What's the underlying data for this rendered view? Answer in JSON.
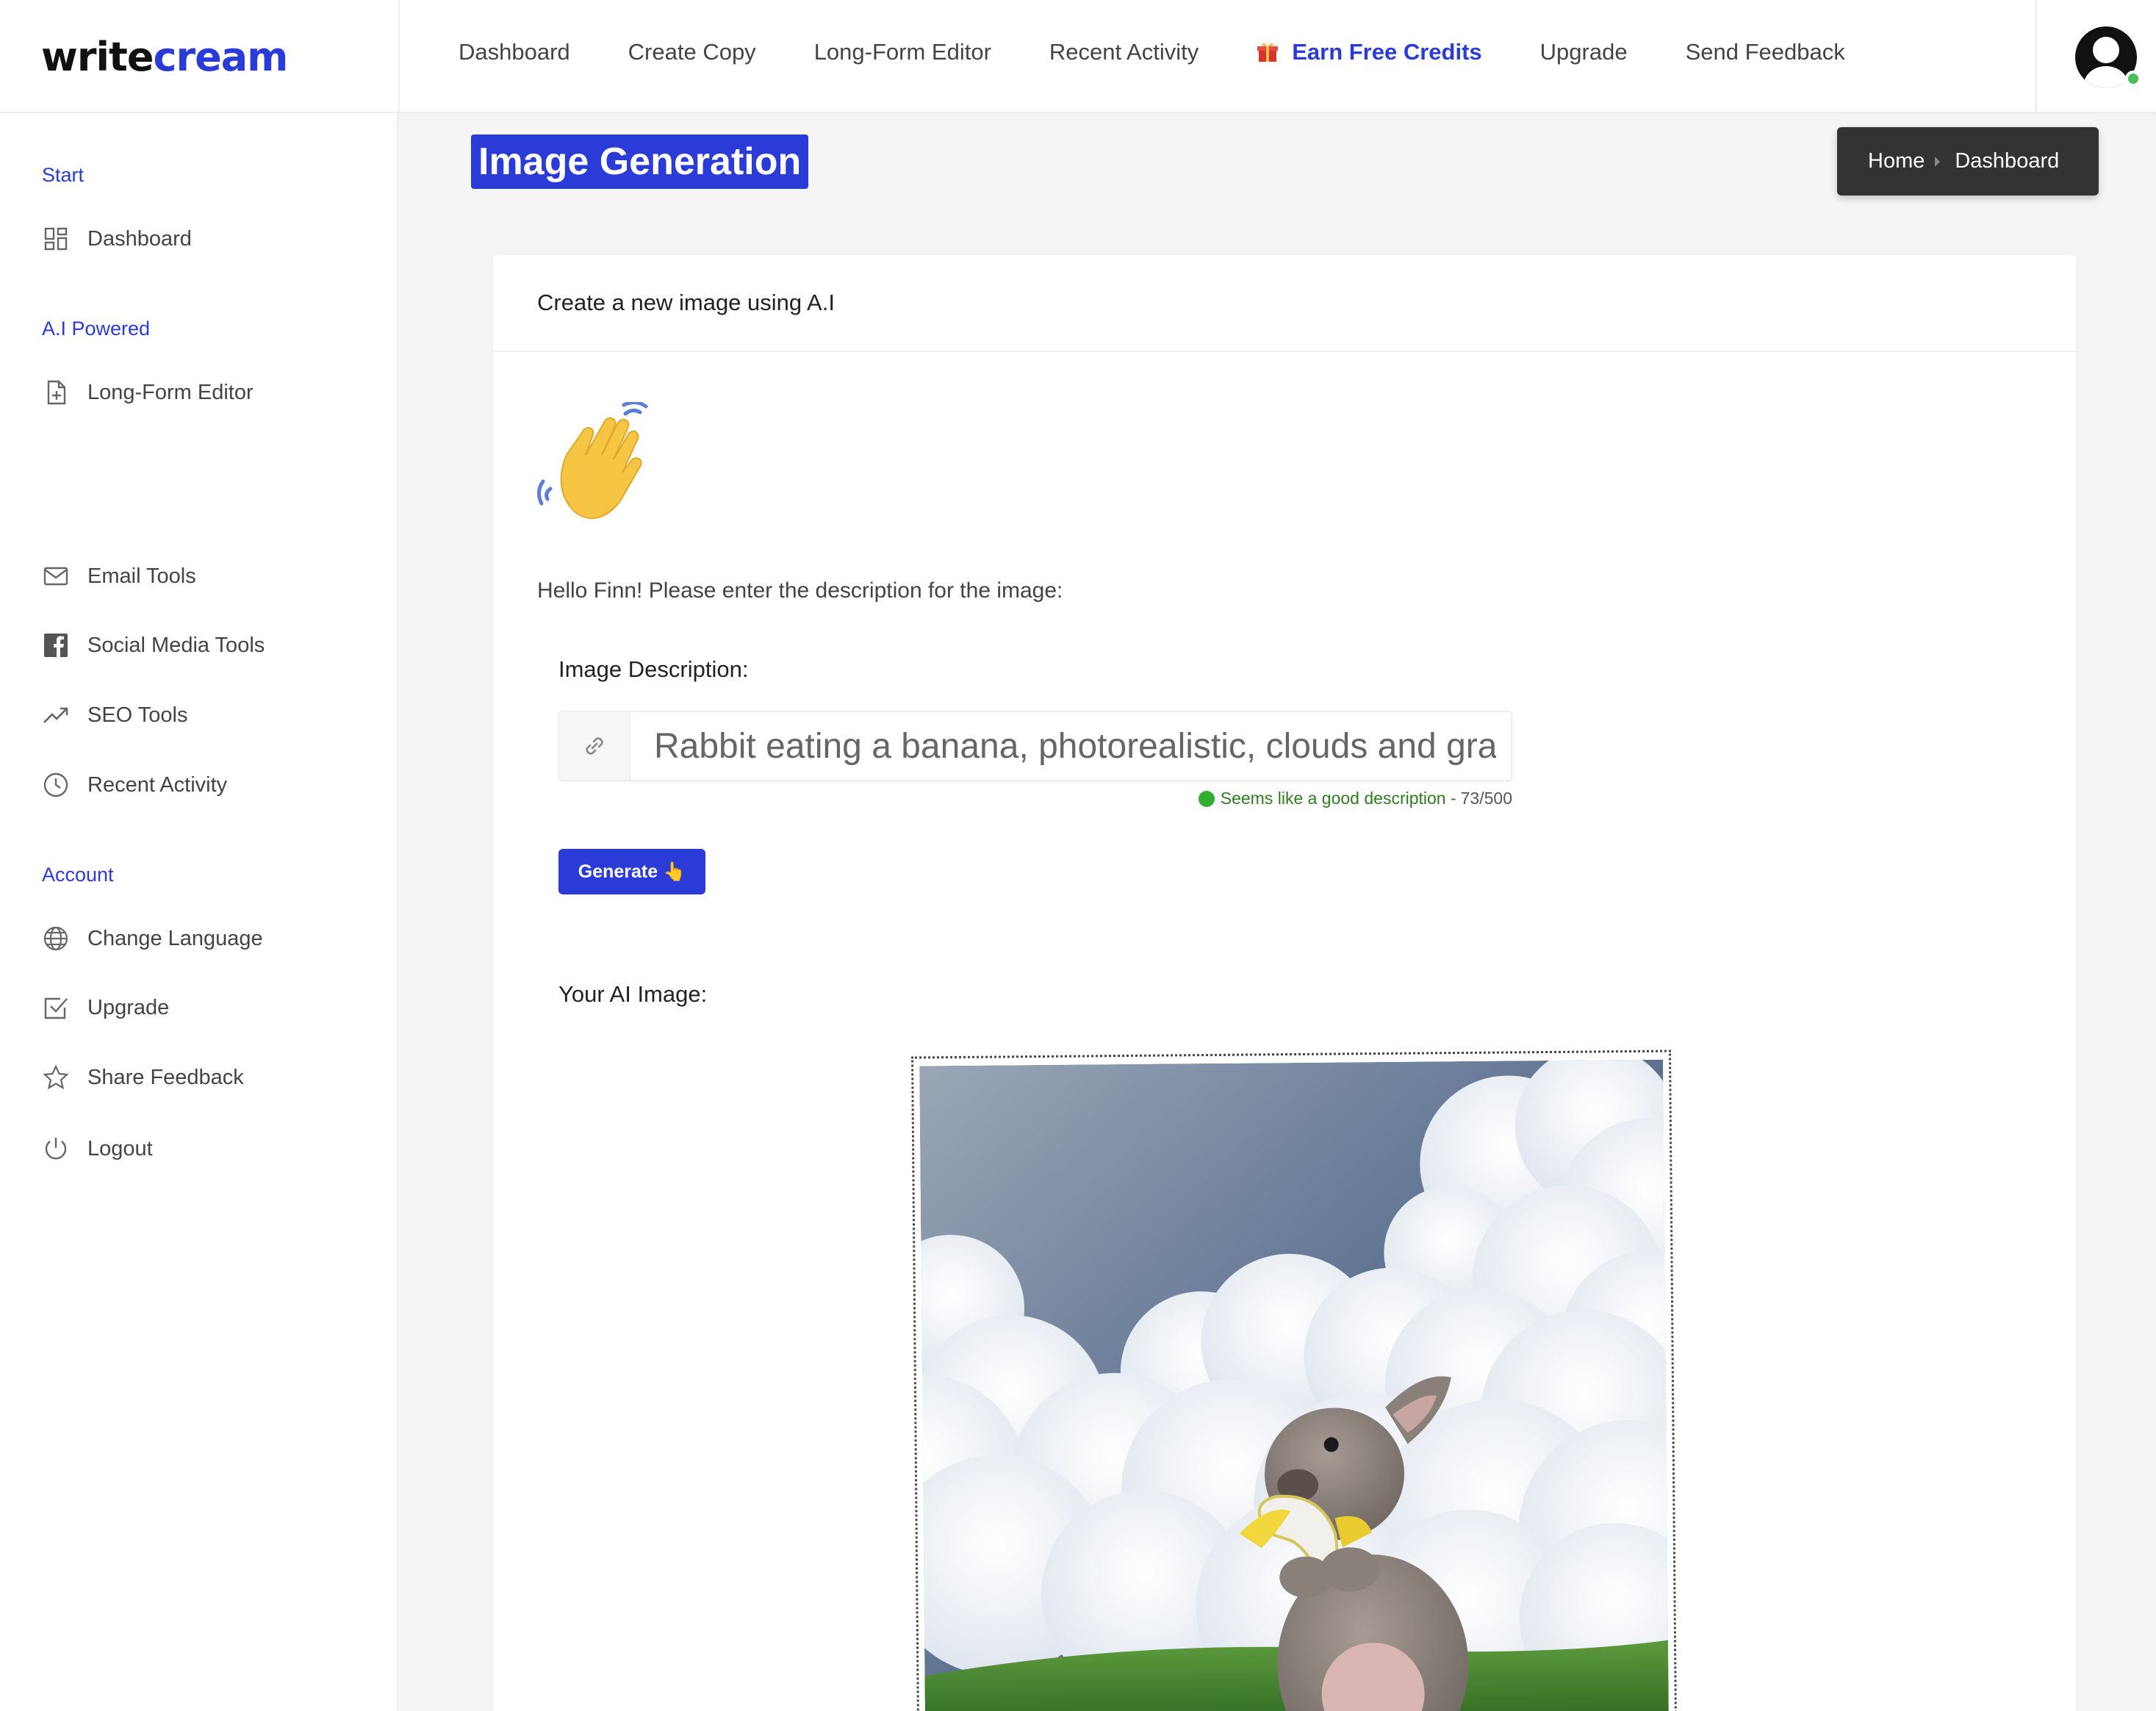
{
  "brand": {
    "part1": "write",
    "part2": "cream"
  },
  "topnav": {
    "items": [
      "Dashboard",
      "Create Copy",
      "Long-Form Editor",
      "Recent Activity"
    ],
    "earn_credits": "Earn Free Credits",
    "upgrade": "Upgrade",
    "send_feedback": "Send Feedback"
  },
  "sidebar": {
    "start_label": "Start",
    "dashboard": "Dashboard",
    "ai_label": "A.I Powered",
    "long_form": "Long-Form Editor",
    "email_tools": "Email Tools",
    "social_tools": "Social Media Tools",
    "seo_tools": "SEO Tools",
    "recent_activity": "Recent Activity",
    "account_label": "Account",
    "change_language": "Change Language",
    "upgrade": "Upgrade",
    "share_feedback": "Share Feedback",
    "logout": "Logout"
  },
  "page": {
    "title": "Image Generation",
    "breadcrumb_home": "Home",
    "breadcrumb_current": "Dashboard"
  },
  "card": {
    "header": "Create a new image using A.I",
    "hello": "Hello Finn! Please enter the description for the image:",
    "desc_label": "Image Description:",
    "desc_value": "Rabbit eating a banana, photorealistic, clouds and grass",
    "hint_text": "Seems like a good description -",
    "hint_count": "73/500",
    "generate_label": "Generate 👆",
    "ai_image_label": "Your AI Image:"
  },
  "colors": {
    "accent": "#2a3bd8",
    "success": "#2e7d1e"
  }
}
